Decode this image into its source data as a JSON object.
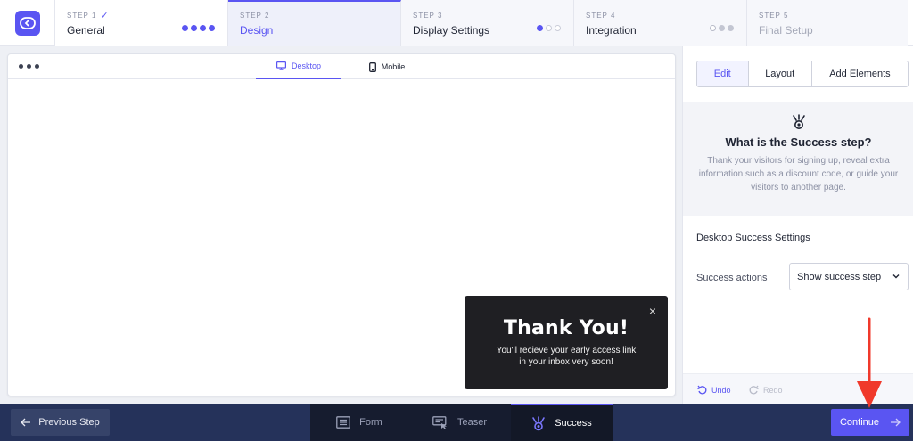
{
  "colors": {
    "accent": "#5a55f2",
    "bottom_bar": "#25325a",
    "annotation": "#f0392b"
  },
  "stepper": {
    "steps": [
      {
        "num": "STEP 1",
        "name": "General",
        "check": "✓"
      },
      {
        "num": "STEP 2",
        "name": "Design"
      },
      {
        "num": "STEP 3",
        "name": "Display Settings"
      },
      {
        "num": "STEP 4",
        "name": "Integration"
      },
      {
        "num": "STEP 5",
        "name": "Final Setup"
      }
    ]
  },
  "preview": {
    "tabs": {
      "desktop": "Desktop",
      "mobile": "Mobile"
    },
    "popup": {
      "title": "Thank You!",
      "message": "You'll recieve your early access link in your inbox very soon!",
      "close": "×"
    }
  },
  "side": {
    "tabs": {
      "edit": "Edit",
      "layout": "Layout",
      "add": "Add Elements"
    },
    "info": {
      "title": "What is the Success step?",
      "text": "Thank your visitors for signing up, reveal extra information such as a discount code, or guide your visitors to another page."
    },
    "settings_title": "Desktop Success Settings",
    "actions_label": "Success actions",
    "actions_value": "Show success step",
    "undo": "Undo",
    "redo": "Redo"
  },
  "bottom": {
    "prev": "Previous Step",
    "modes": {
      "form": "Form",
      "teaser": "Teaser",
      "success": "Success"
    },
    "continue": "Continue"
  }
}
